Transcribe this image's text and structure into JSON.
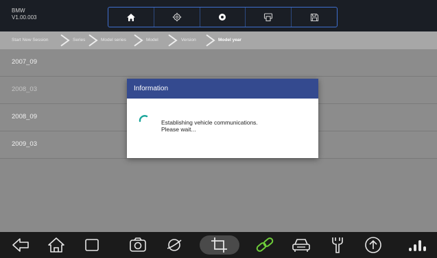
{
  "header": {
    "app_name": "BMW",
    "version": "V1.00.003",
    "toolbar": [
      {
        "icon": "home-icon"
      },
      {
        "icon": "gear-icon"
      },
      {
        "icon": "record-icon"
      },
      {
        "icon": "print-icon"
      },
      {
        "icon": "save-icon"
      }
    ]
  },
  "breadcrumb": {
    "items": [
      "Start New Session",
      "Series",
      "Model series",
      "Model",
      "Version",
      "Model year"
    ],
    "active_index": 5
  },
  "list": {
    "items": [
      "2007_09",
      "2008_03",
      "2008_09",
      "2009_03"
    ]
  },
  "dialog": {
    "title": "Information",
    "message_line1": "Establishing vehicle communications.",
    "message_line2": "Please wait..."
  },
  "bottom_nav": [
    {
      "icon": "back-icon"
    },
    {
      "icon": "home-icon"
    },
    {
      "icon": "recent-apps-icon"
    },
    {
      "icon": "camera-icon"
    },
    {
      "icon": "browser-icon"
    },
    {
      "icon": "crop-icon"
    },
    {
      "icon": "link-icon"
    },
    {
      "icon": "car-icon"
    },
    {
      "icon": "tools-icon"
    },
    {
      "icon": "upload-icon"
    },
    {
      "icon": "signal-icon"
    }
  ],
  "colors": {
    "topbar": "#1a1e25",
    "toolbar_border": "#3f6fd0",
    "dialog_header": "#344a8f",
    "spinner": "#1aa59a",
    "link_icon": "#6fcf3a"
  }
}
